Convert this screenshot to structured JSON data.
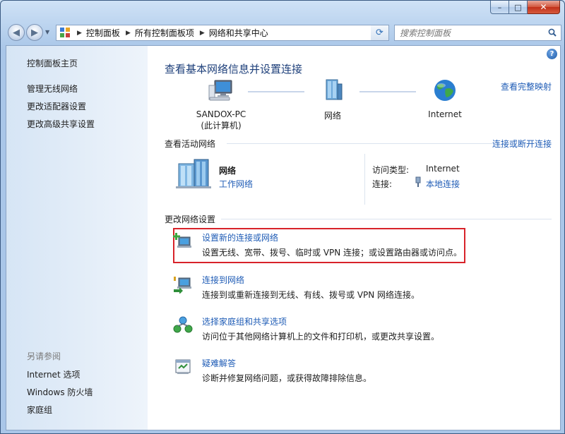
{
  "window": {
    "caption_buttons": {
      "minimize": "–",
      "maximize": "□",
      "close": "✕"
    }
  },
  "address_bar": {
    "crumbs": [
      "控制面板",
      "所有控制面板项",
      "网络和共享中心"
    ]
  },
  "search": {
    "placeholder": "搜索控制面板"
  },
  "sidebar": {
    "top_links": [
      "控制面板主页",
      "管理无线网络",
      "更改适配器设置",
      "更改高级共享设置"
    ],
    "see_also_heading": "另请参阅",
    "see_also_links": [
      "Internet 选项",
      "Windows 防火墙",
      "家庭组"
    ]
  },
  "main": {
    "title": "查看基本网络信息并设置连接",
    "full_map_link": "查看完整映射",
    "network_map": {
      "computer_name": "SANDOX-PC",
      "computer_sub": "(此计算机)",
      "network": "网络",
      "internet": "Internet"
    },
    "active_networks": {
      "heading": "查看活动网络",
      "connect_link": "连接或断开连接",
      "network_name": "网络",
      "network_type": "工作网络",
      "access_type_label": "访问类型:",
      "access_type_value": "Internet",
      "connections_label": "连接:",
      "connections_value": "本地连接"
    },
    "change_settings": {
      "heading": "更改网络设置",
      "tasks": [
        {
          "link": "设置新的连接或网络",
          "desc": "设置无线、宽带、拨号、临时或 VPN 连接；或设置路由器或访问点。"
        },
        {
          "link": "连接到网络",
          "desc": "连接到或重新连接到无线、有线、拨号或 VPN 网络连接。"
        },
        {
          "link": "选择家庭组和共享选项",
          "desc": "访问位于其他网络计算机上的文件和打印机，或更改共享设置。"
        },
        {
          "link": "疑难解答",
          "desc": "诊断并修复网络问题，或获得故障排除信息。"
        }
      ]
    }
  },
  "colors": {
    "link": "#1f5cb6",
    "title": "#1d3f7a",
    "highlight": "#d8232a"
  }
}
